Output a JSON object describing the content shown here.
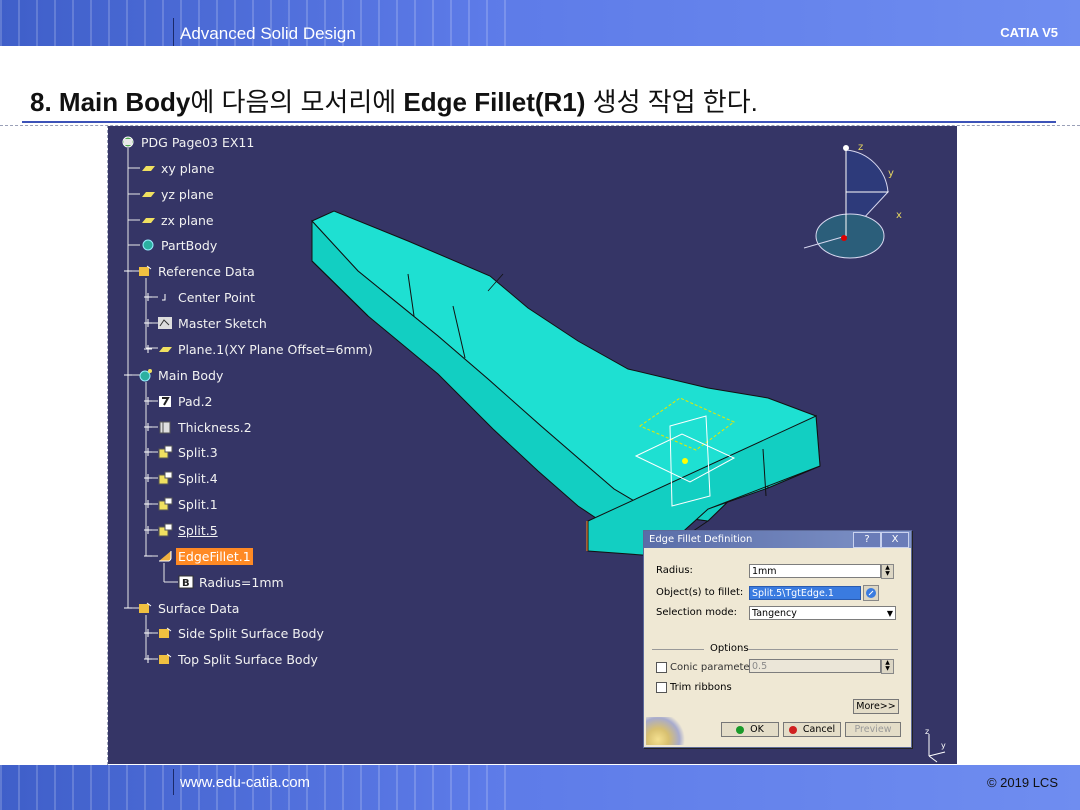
{
  "header": {
    "title": "Advanced Solid Design",
    "brand": "CATIA V5"
  },
  "heading": {
    "num": "8.",
    "bold1": "Main Body",
    "text1": "에 다음의 모서리에 ",
    "bold2": "Edge Fillet(R1)",
    "text2": " 생성 작업 한다."
  },
  "tree": {
    "root": "PDG Page03 EX11",
    "items": [
      "xy plane",
      "yz plane",
      "zx plane",
      "PartBody",
      "Reference Data",
      "Center Point",
      "Master Sketch",
      "Plane.1(XY Plane Offset=6mm)",
      "Main Body",
      "Pad.2",
      "Thickness.2",
      "Split.3",
      "Split.4",
      "Split.1",
      "Split.5",
      "EdgeFillet.1",
      "Radius=1mm",
      "Surface Data",
      "Side Split Surface Body",
      "Top Split Surface Body"
    ]
  },
  "compass": {
    "z": "z",
    "y": "y",
    "x": "x"
  },
  "dialog": {
    "title": "Edge Fillet Definition",
    "help": "?",
    "close": "X",
    "radius_label": "Radius:",
    "radius_value": "1mm",
    "objects_label": "Object(s) to fillet:",
    "objects_value": "Split.5\\TgtEdge.1",
    "mode_label": "Selection mode:",
    "mode_value": "Tangency",
    "options_label": "Options",
    "conic_label": "Conic parameter:",
    "conic_value": "0.5",
    "trim_label": "Trim ribbons",
    "more_label": "More>>",
    "ok_label": "OK",
    "cancel_label": "Cancel",
    "preview_label": "Preview"
  },
  "footer": {
    "url": "www.edu-catia.com",
    "copyright": "© 2019 LCS"
  },
  "colors": {
    "bar": "#5d7be8",
    "viewport": "#353566",
    "part": "#19dccf",
    "selected": "#ff8a24"
  }
}
